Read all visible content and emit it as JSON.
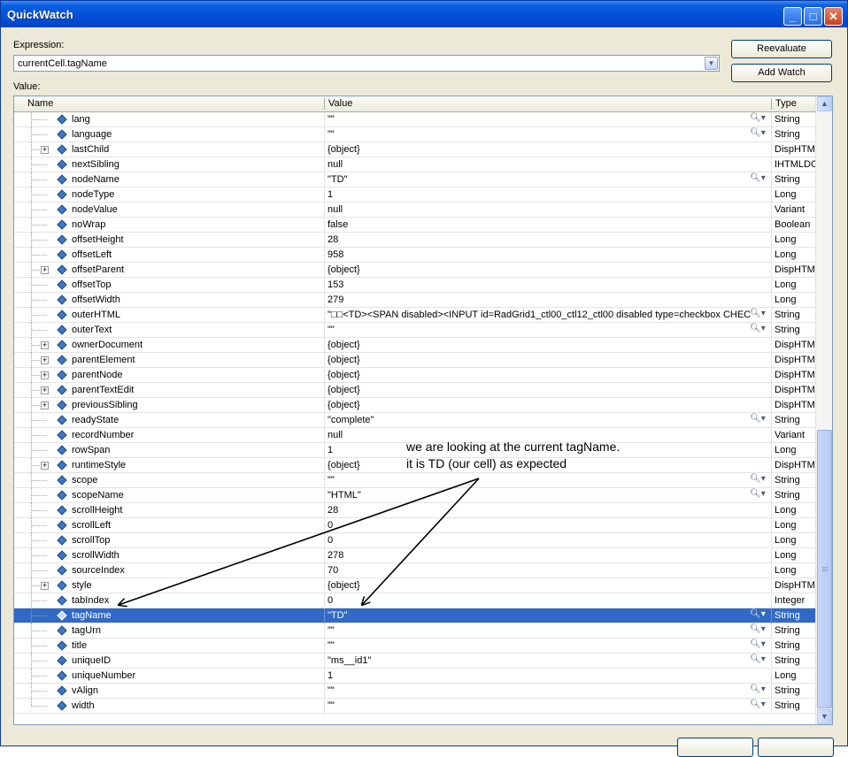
{
  "window": {
    "title": "QuickWatch"
  },
  "expression": {
    "label": "Expression:",
    "value": "currentCell.tagName"
  },
  "buttons": {
    "reevaluate": "Reevaluate",
    "add_watch": "Add Watch"
  },
  "value_label": "Value:",
  "grid": {
    "columns": {
      "name": "Name",
      "value": "Value",
      "type": "Type"
    },
    "rows": [
      {
        "name": "lang",
        "value": "\"\"",
        "type": "String",
        "expandable": false,
        "magnifier": true,
        "selected": false
      },
      {
        "name": "language",
        "value": "\"\"",
        "type": "String",
        "expandable": false,
        "magnifier": true,
        "selected": false
      },
      {
        "name": "lastChild",
        "value": "{object}",
        "type": "DispHTML",
        "expandable": true,
        "magnifier": false,
        "selected": false
      },
      {
        "name": "nextSibling",
        "value": "null",
        "type": "IHTMLDO",
        "expandable": false,
        "magnifier": false,
        "selected": false
      },
      {
        "name": "nodeName",
        "value": "\"TD\"",
        "type": "String",
        "expandable": false,
        "magnifier": true,
        "selected": false
      },
      {
        "name": "nodeType",
        "value": "1",
        "type": "Long",
        "expandable": false,
        "magnifier": false,
        "selected": false
      },
      {
        "name": "nodeValue",
        "value": "null",
        "type": "Variant",
        "expandable": false,
        "magnifier": false,
        "selected": false
      },
      {
        "name": "noWrap",
        "value": "false",
        "type": "Boolean",
        "expandable": false,
        "magnifier": false,
        "selected": false
      },
      {
        "name": "offsetHeight",
        "value": "28",
        "type": "Long",
        "expandable": false,
        "magnifier": false,
        "selected": false
      },
      {
        "name": "offsetLeft",
        "value": "958",
        "type": "Long",
        "expandable": false,
        "magnifier": false,
        "selected": false
      },
      {
        "name": "offsetParent",
        "value": "{object}",
        "type": "DispHTML",
        "expandable": true,
        "magnifier": false,
        "selected": false
      },
      {
        "name": "offsetTop",
        "value": "153",
        "type": "Long",
        "expandable": false,
        "magnifier": false,
        "selected": false
      },
      {
        "name": "offsetWidth",
        "value": "279",
        "type": "Long",
        "expandable": false,
        "magnifier": false,
        "selected": false
      },
      {
        "name": "outerHTML",
        "value": "\"□□<TD><SPAN disabled><INPUT id=RadGrid1_ctl00_ctl12_ctl00 disabled type=checkbox CHEC",
        "type": "String",
        "expandable": false,
        "magnifier": true,
        "selected": false
      },
      {
        "name": "outerText",
        "value": "\"\"",
        "type": "String",
        "expandable": false,
        "magnifier": true,
        "selected": false
      },
      {
        "name": "ownerDocument",
        "value": "{object}",
        "type": "DispHTML",
        "expandable": true,
        "magnifier": false,
        "selected": false
      },
      {
        "name": "parentElement",
        "value": "{object}",
        "type": "DispHTML",
        "expandable": true,
        "magnifier": false,
        "selected": false
      },
      {
        "name": "parentNode",
        "value": "{object}",
        "type": "DispHTML",
        "expandable": true,
        "magnifier": false,
        "selected": false
      },
      {
        "name": "parentTextEdit",
        "value": "{object}",
        "type": "DispHTML",
        "expandable": true,
        "magnifier": false,
        "selected": false
      },
      {
        "name": "previousSibling",
        "value": "{object}",
        "type": "DispHTML",
        "expandable": true,
        "magnifier": false,
        "selected": false
      },
      {
        "name": "readyState",
        "value": "\"complete\"",
        "type": "String",
        "expandable": false,
        "magnifier": true,
        "selected": false
      },
      {
        "name": "recordNumber",
        "value": "null",
        "type": "Variant",
        "expandable": false,
        "magnifier": false,
        "selected": false
      },
      {
        "name": "rowSpan",
        "value": "1",
        "type": "Long",
        "expandable": false,
        "magnifier": false,
        "selected": false
      },
      {
        "name": "runtimeStyle",
        "value": "{object}",
        "type": "DispHTML",
        "expandable": true,
        "magnifier": false,
        "selected": false
      },
      {
        "name": "scope",
        "value": "\"\"",
        "type": "String",
        "expandable": false,
        "magnifier": true,
        "selected": false
      },
      {
        "name": "scopeName",
        "value": "\"HTML\"",
        "type": "String",
        "expandable": false,
        "magnifier": true,
        "selected": false
      },
      {
        "name": "scrollHeight",
        "value": "28",
        "type": "Long",
        "expandable": false,
        "magnifier": false,
        "selected": false
      },
      {
        "name": "scrollLeft",
        "value": "0",
        "type": "Long",
        "expandable": false,
        "magnifier": false,
        "selected": false
      },
      {
        "name": "scrollTop",
        "value": "0",
        "type": "Long",
        "expandable": false,
        "magnifier": false,
        "selected": false
      },
      {
        "name": "scrollWidth",
        "value": "278",
        "type": "Long",
        "expandable": false,
        "magnifier": false,
        "selected": false
      },
      {
        "name": "sourceIndex",
        "value": "70",
        "type": "Long",
        "expandable": false,
        "magnifier": false,
        "selected": false
      },
      {
        "name": "style",
        "value": "{object}",
        "type": "DispHTML",
        "expandable": true,
        "magnifier": false,
        "selected": false
      },
      {
        "name": "tabIndex",
        "value": "0",
        "type": "Integer",
        "expandable": false,
        "magnifier": false,
        "selected": false
      },
      {
        "name": "tagName",
        "value": "\"TD\"",
        "type": "String",
        "expandable": false,
        "magnifier": true,
        "selected": true
      },
      {
        "name": "tagUrn",
        "value": "\"\"",
        "type": "String",
        "expandable": false,
        "magnifier": true,
        "selected": false
      },
      {
        "name": "title",
        "value": "\"\"",
        "type": "String",
        "expandable": false,
        "magnifier": true,
        "selected": false
      },
      {
        "name": "uniqueID",
        "value": "\"ms__id1\"",
        "type": "String",
        "expandable": false,
        "magnifier": true,
        "selected": false
      },
      {
        "name": "uniqueNumber",
        "value": "1",
        "type": "Long",
        "expandable": false,
        "magnifier": false,
        "selected": false
      },
      {
        "name": "vAlign",
        "value": "\"\"",
        "type": "String",
        "expandable": false,
        "magnifier": true,
        "selected": false
      },
      {
        "name": "width",
        "value": "\"\"",
        "type": "String",
        "expandable": false,
        "magnifier": true,
        "selected": false
      }
    ]
  },
  "annotation": {
    "line1": "we are looking at the current tagName.",
    "line2": "it is TD (our cell) as expected"
  },
  "colors": {
    "selection": "#316ac5",
    "titlebar": "#0450d8",
    "window_bg": "#ece9d8"
  }
}
